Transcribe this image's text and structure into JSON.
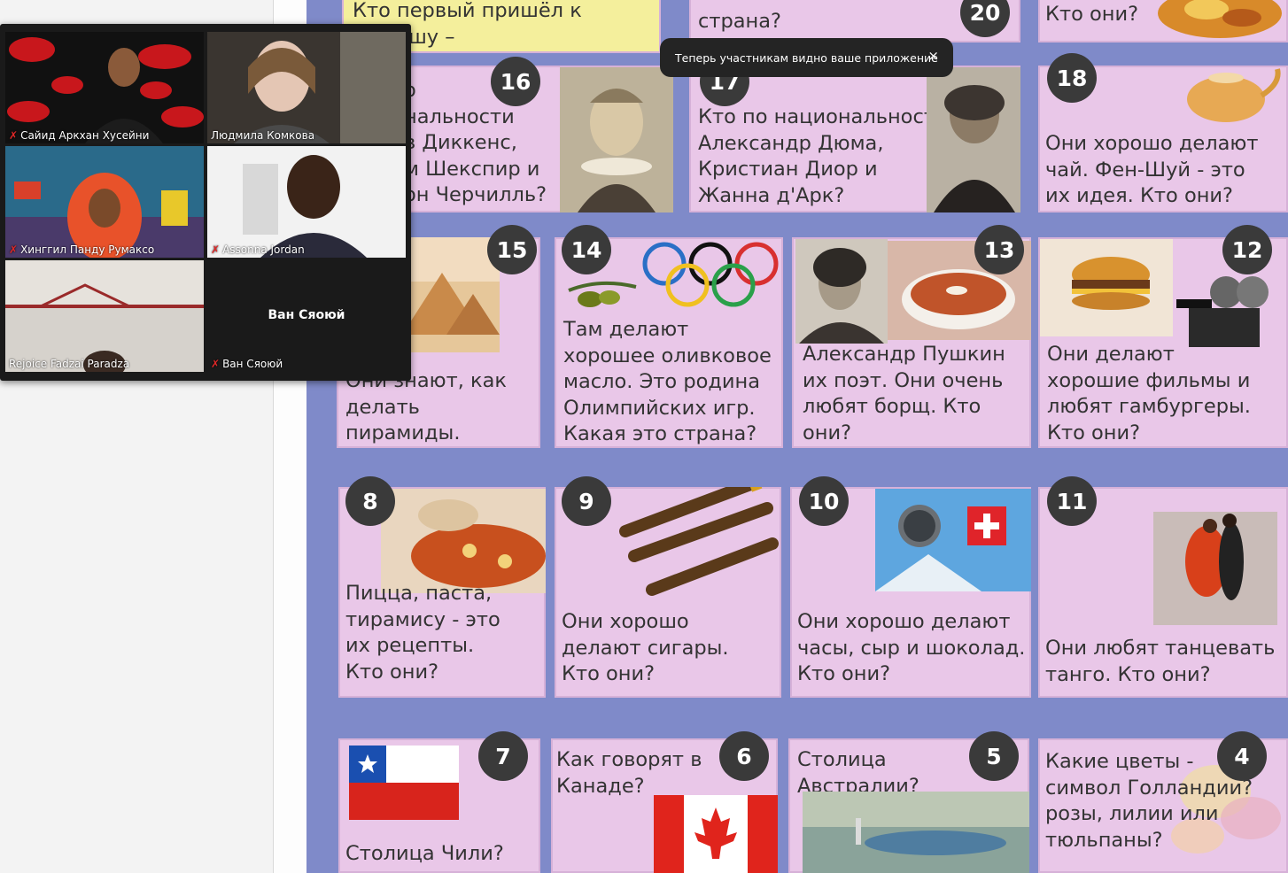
{
  "toast": {
    "message": "Теперь участникам видно ваше приложение",
    "close_label": "×"
  },
  "participants": [
    {
      "name": "Сайид Аркхан Хусейни"
    },
    {
      "name": "Людмила Комкова"
    },
    {
      "name": "Хинггил Панду Румаксо"
    },
    {
      "name": "Assonna Jordan"
    },
    {
      "name": "Rejoice Fadzai Paradza"
    },
    {
      "name": "Ван Сяоюй",
      "center_label": "Ван Сяоюй"
    }
  ],
  "cards": {
    "c_top_left": {
      "text": "Кто первый пришёл к финишу –\n  итель."
    },
    "c_top_mid": {
      "text": "страна?"
    },
    "c20": {
      "number": "20"
    },
    "c_top_right": {
      "text": "Кто они?"
    },
    "c16": {
      "number": "16",
      "text": "о\nнальности\nв Диккенс,\nм Шекспир и\nон Черчилль?"
    },
    "c17": {
      "number": "17",
      "text": "Кто по национальности\nАлександр Дюма,\nКристиан Диор и\nЖанна д'Арк?"
    },
    "c18": {
      "number": "18",
      "text": "Они хорошо делают\nчай. Фен-Шуй - это\nих идея. Кто они?"
    },
    "c15": {
      "number": "15",
      "text": "Они знают, как\nделать пирамиды.\nКто они?"
    },
    "c14": {
      "number": "14",
      "text": "Там делают\nхорошее оливковое\nмасло. Это родина\nОлимпийских игр.\nКакая это страна?"
    },
    "c13": {
      "number": "13",
      "text": "Александр Пушкин\nих поэт. Они очень\nлюбят борщ. Кто\nони?"
    },
    "c12": {
      "number": "12",
      "text": "Они делают\nхорошие фильмы и\nлюбят гамбургеры.\nКто они?"
    },
    "c8": {
      "number": "8",
      "text": "Пицца, паста,\nтирамису - это\nих рецепты.\nКто они?"
    },
    "c9": {
      "number": "9",
      "text": "Они хорошо\nделают сигары.\nКто они?"
    },
    "c10": {
      "number": "10",
      "text": "Они хорошо делают\nчасы, сыр и шоколад.\nКто они?"
    },
    "c11": {
      "number": "11",
      "text": "Они любят танцевать\nтанго. Кто они?"
    },
    "c7": {
      "number": "7",
      "text": "Столица Чили?"
    },
    "c6": {
      "number": "6",
      "text": "Как говорят в\nКанаде?"
    },
    "c5": {
      "number": "5",
      "text": "Столица\nАвстралии?"
    },
    "c4": {
      "number": "4",
      "text": "Какие цветы -\nсимвол Голландии?\nрозы, лилии или\nтюльпаны?"
    }
  },
  "colors": {
    "board": "#7f8ac9",
    "card": "#e9c7e8",
    "badge": "#3a3a3a",
    "active_tile_border": "#9acd32",
    "muted_mic": "#e02828"
  }
}
